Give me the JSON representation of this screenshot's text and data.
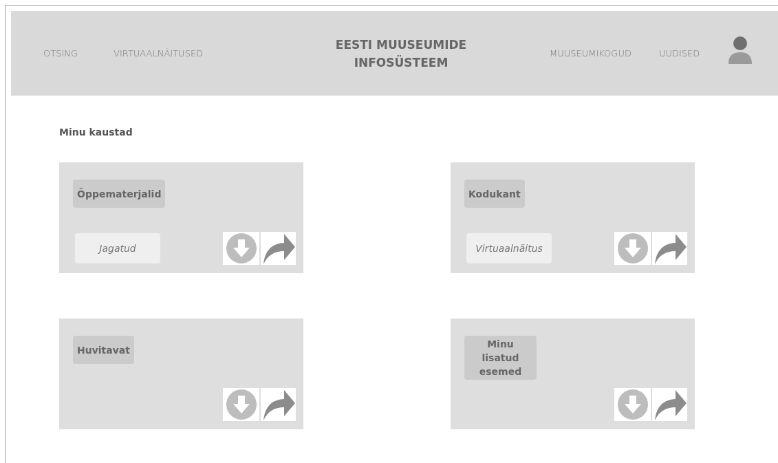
{
  "header": {
    "nav_left": [
      "OTSING",
      "VIRTUAALNÄITUSED"
    ],
    "title": "EESTI MUUSEUMIDE INFOSÜSTEEM",
    "nav_right": [
      "MUUSEUMIKOGUD",
      "UUDISED"
    ]
  },
  "section_title": "Minu kaustad",
  "folders": [
    {
      "title": "Õppematerjalid",
      "tag": "Jagatud"
    },
    {
      "title": "Kodukant",
      "tag": "Virtuaalnäitus"
    },
    {
      "title": "Huvitavat"
    },
    {
      "title": "Minu lisatud esemed"
    }
  ]
}
